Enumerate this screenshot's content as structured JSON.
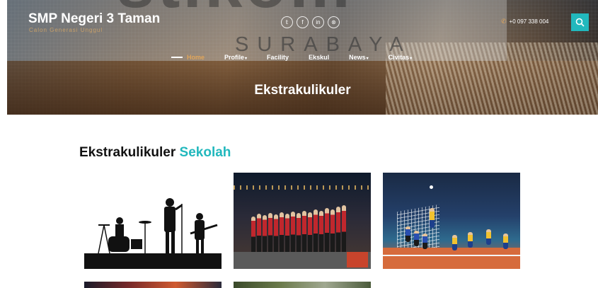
{
  "header": {
    "brand_title": "SMP Negeri 3 Taman",
    "brand_subtitle": "Calon Generasi Unggul",
    "watermark_big": "stikom",
    "watermark_sub": "SURABAYA",
    "phone": "+0 097 338 004",
    "social": [
      {
        "icon": "twitter-icon",
        "glyph": "𝕥"
      },
      {
        "icon": "facebook-icon",
        "glyph": "f"
      },
      {
        "icon": "linkedin-icon",
        "glyph": "in"
      },
      {
        "icon": "dribbble-icon",
        "glyph": "⊛"
      }
    ]
  },
  "nav": {
    "items": [
      {
        "label": "Home",
        "active": true
      },
      {
        "label": "Profile",
        "dropdown": true
      },
      {
        "label": "Facility"
      },
      {
        "label": "Ekskul"
      },
      {
        "label": "News",
        "dropdown": true
      },
      {
        "label": "Civitas",
        "dropdown": true
      }
    ]
  },
  "banner": {
    "title": "Ekstrakulikuler"
  },
  "section": {
    "heading_main": "Ekstrakulikuler",
    "heading_accent": "Sekolah"
  },
  "colors": {
    "accent": "#22b8bd",
    "nav_active": "#e0a55a"
  }
}
